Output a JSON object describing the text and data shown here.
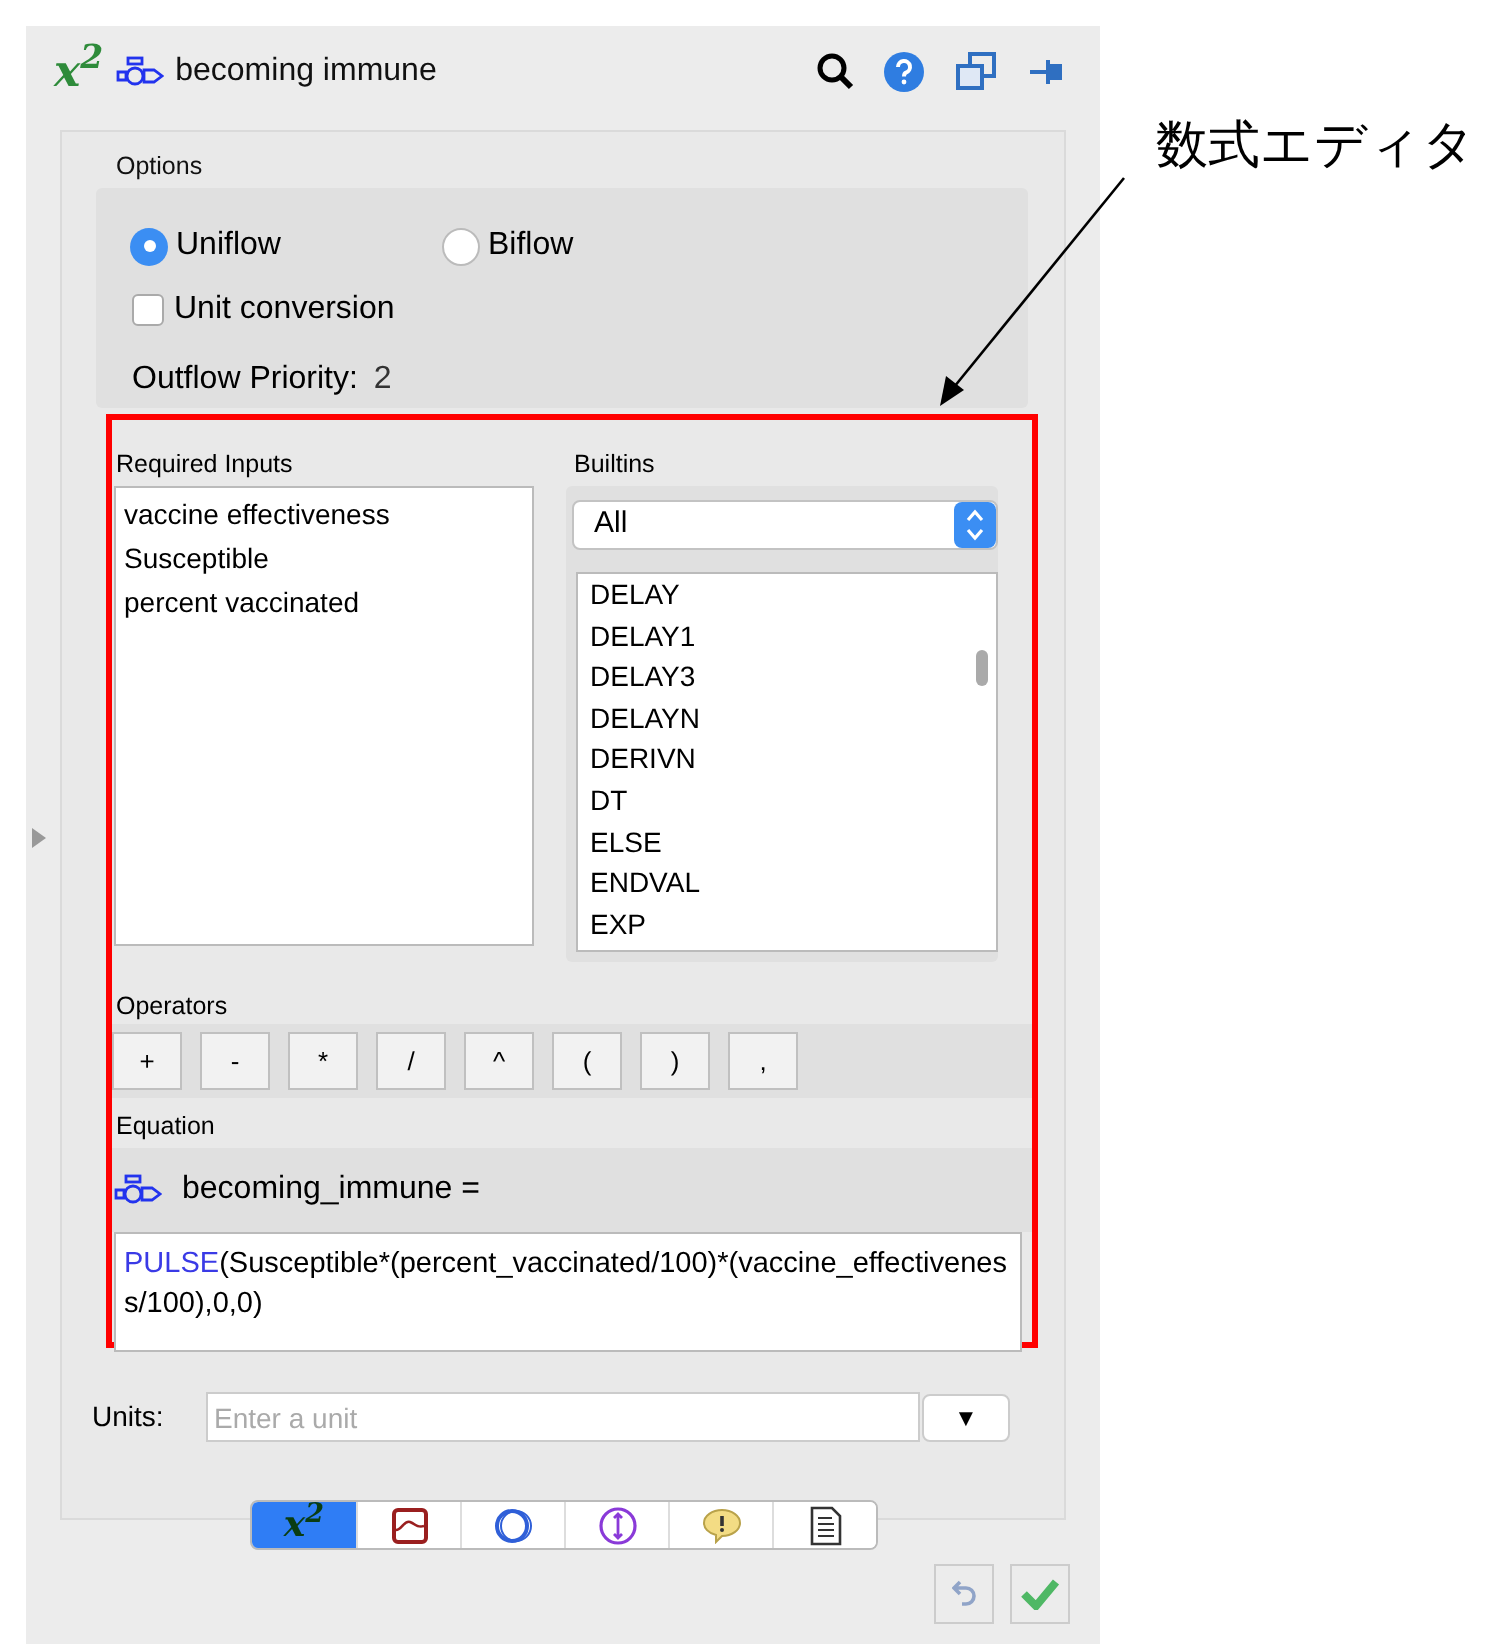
{
  "header": {
    "logo": "x$^{2}$",
    "title": "becoming immune"
  },
  "options": {
    "label": "Options",
    "radios": [
      {
        "label": "Uniflow",
        "selected": true
      },
      {
        "label": "Biflow",
        "selected": false
      }
    ],
    "unit_conversion": {
      "label": "Unit conversion",
      "checked": false
    },
    "outflow_priority": {
      "label": "Outflow Priority:",
      "value": "2"
    }
  },
  "required_inputs": {
    "label": "Required Inputs",
    "items": [
      "vaccine effectiveness",
      "Susceptible",
      "percent vaccinated"
    ]
  },
  "builtins": {
    "label": "Builtins",
    "select_value": "All",
    "items": [
      "DELAY",
      "DELAY1",
      "DELAY3",
      "DELAYN",
      "DERIVN",
      "DT",
      "ELSE",
      "ENDVAL",
      "EXP"
    ]
  },
  "operators": {
    "label": "Operators",
    "buttons": [
      "+",
      "-",
      "*",
      "/",
      "^",
      "(",
      ")",
      ","
    ]
  },
  "equation": {
    "label": "Equation",
    "lhs": "becoming_immune =",
    "function": "PULSE",
    "arguments": "(Susceptible*(percent_vaccinated/100)*(vaccine_effectiveness/100),0,0)"
  },
  "units": {
    "label": "Units:",
    "placeholder": "Enter a unit",
    "dropdown": "▼"
  },
  "tabs": [
    {
      "kind": "equation",
      "label": "x$^{2}$",
      "selected": true
    },
    {
      "kind": "graph",
      "selected": false
    },
    {
      "kind": "circles",
      "selected": false
    },
    {
      "kind": "range",
      "selected": false
    },
    {
      "kind": "warning",
      "selected": false
    },
    {
      "kind": "document",
      "selected": false
    }
  ],
  "annotation": {
    "label": "数式エディタ"
  }
}
